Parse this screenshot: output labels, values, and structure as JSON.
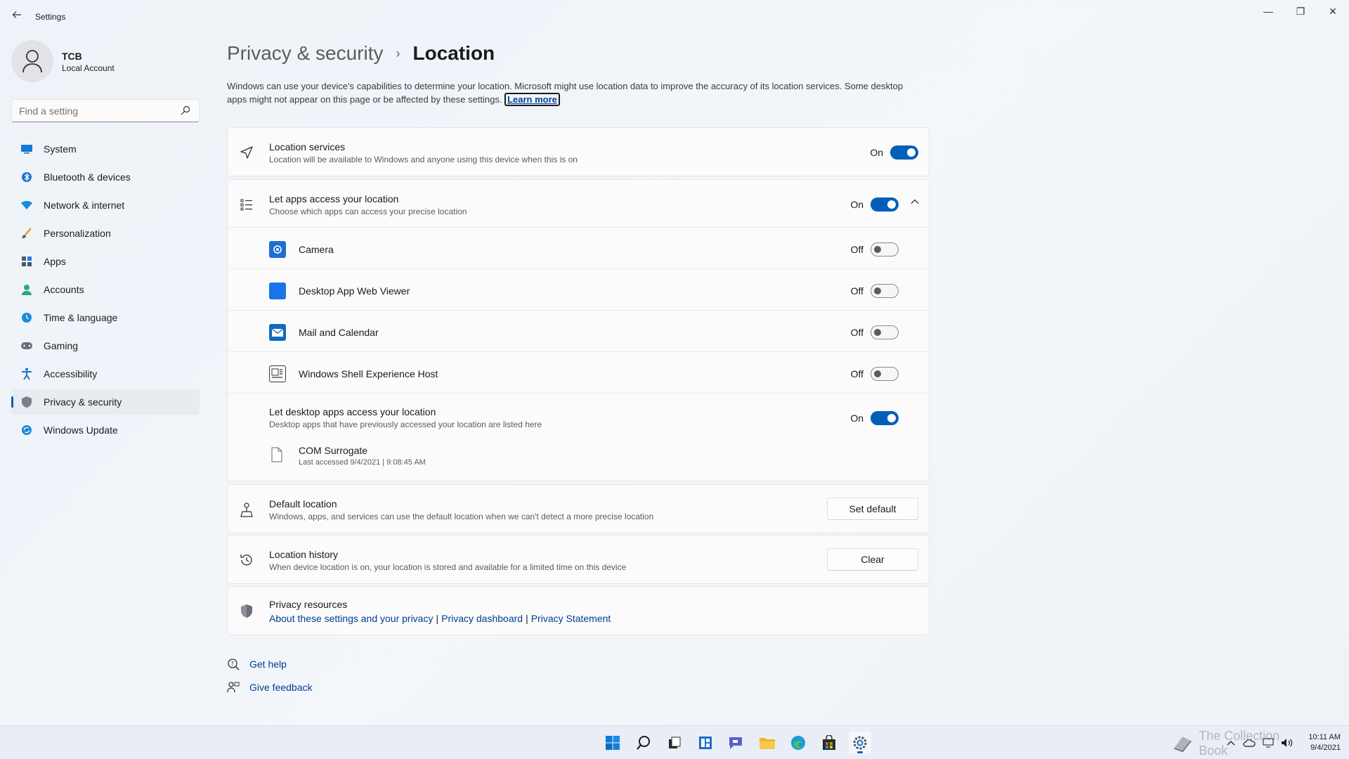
{
  "window": {
    "title": "Settings",
    "back_icon": "arrow-left-icon",
    "controls": {
      "minimize": "—",
      "maximize": "❐",
      "close": "✕"
    }
  },
  "profile": {
    "name": "TCB",
    "account_type": "Local Account"
  },
  "search": {
    "placeholder": "Find a setting"
  },
  "sidebar": {
    "items": [
      {
        "label": "System",
        "icon": "monitor-icon"
      },
      {
        "label": "Bluetooth & devices",
        "icon": "bluetooth-icon"
      },
      {
        "label": "Network & internet",
        "icon": "wifi-icon"
      },
      {
        "label": "Personalization",
        "icon": "brush-icon"
      },
      {
        "label": "Apps",
        "icon": "apps-icon"
      },
      {
        "label": "Accounts",
        "icon": "person-icon"
      },
      {
        "label": "Time & language",
        "icon": "globe-clock-icon"
      },
      {
        "label": "Gaming",
        "icon": "gamepad-icon"
      },
      {
        "label": "Accessibility",
        "icon": "accessibility-icon"
      },
      {
        "label": "Privacy & security",
        "icon": "shield-icon",
        "selected": true
      },
      {
        "label": "Windows Update",
        "icon": "update-icon"
      }
    ]
  },
  "breadcrumb": {
    "parent": "Privacy & security",
    "separator": "›",
    "current": "Location"
  },
  "description": {
    "text": "Windows can use your device's capabilities to determine your location. Microsoft might use location data to improve the accuracy of its location services. Some desktop apps might not appear on this page or be affected by these settings.",
    "learn_more": "Learn more"
  },
  "location_services": {
    "title": "Location services",
    "subtitle": "Location will be available to Windows and anyone using this device when this is on",
    "state": "On"
  },
  "app_access": {
    "title": "Let apps access your location",
    "subtitle": "Choose which apps can access your precise location",
    "state": "On",
    "apps": [
      {
        "name": "Camera",
        "state": "Off",
        "color": "#1f6fd1"
      },
      {
        "name": "Desktop App Web Viewer",
        "state": "Off",
        "color": "#1a73e8"
      },
      {
        "name": "Mail and Calendar",
        "state": "Off",
        "color": "#0f6cbd"
      },
      {
        "name": "Windows Shell Experience Host",
        "state": "Off",
        "color": "#3a3a3a"
      }
    ]
  },
  "desktop_access": {
    "title": "Let desktop apps access your location",
    "subtitle": "Desktop apps that have previously accessed your location are listed here",
    "state": "On",
    "apps": [
      {
        "name": "COM Surrogate",
        "last_accessed": "Last accessed 9/4/2021  |  9:08:45 AM"
      }
    ]
  },
  "default_location": {
    "title": "Default location",
    "subtitle": "Windows, apps, and services can use the default location when we can't detect a more precise location",
    "button": "Set default"
  },
  "location_history": {
    "title": "Location history",
    "subtitle": "When device location is on, your location is stored and available for a limited time on this device",
    "button": "Clear"
  },
  "privacy_resources": {
    "title": "Privacy resources",
    "links": [
      "About these settings and your privacy",
      "Privacy dashboard",
      "Privacy Statement"
    ],
    "pipe": "|"
  },
  "help": {
    "get_help": "Get help",
    "give_feedback": "Give feedback"
  },
  "taskbar": {
    "icons": [
      "windows-start-icon",
      "search-icon",
      "task-view-icon",
      "widgets-icon",
      "chat-icon",
      "file-explorer-icon",
      "edge-icon",
      "store-icon",
      "settings-icon"
    ],
    "clock_time": "10:11 AM",
    "clock_date": "9/4/2021",
    "watermark": "The Collection Book"
  },
  "colors": {
    "accent": "#005fb8",
    "link": "#003e92",
    "background": "#f3f6fa"
  }
}
